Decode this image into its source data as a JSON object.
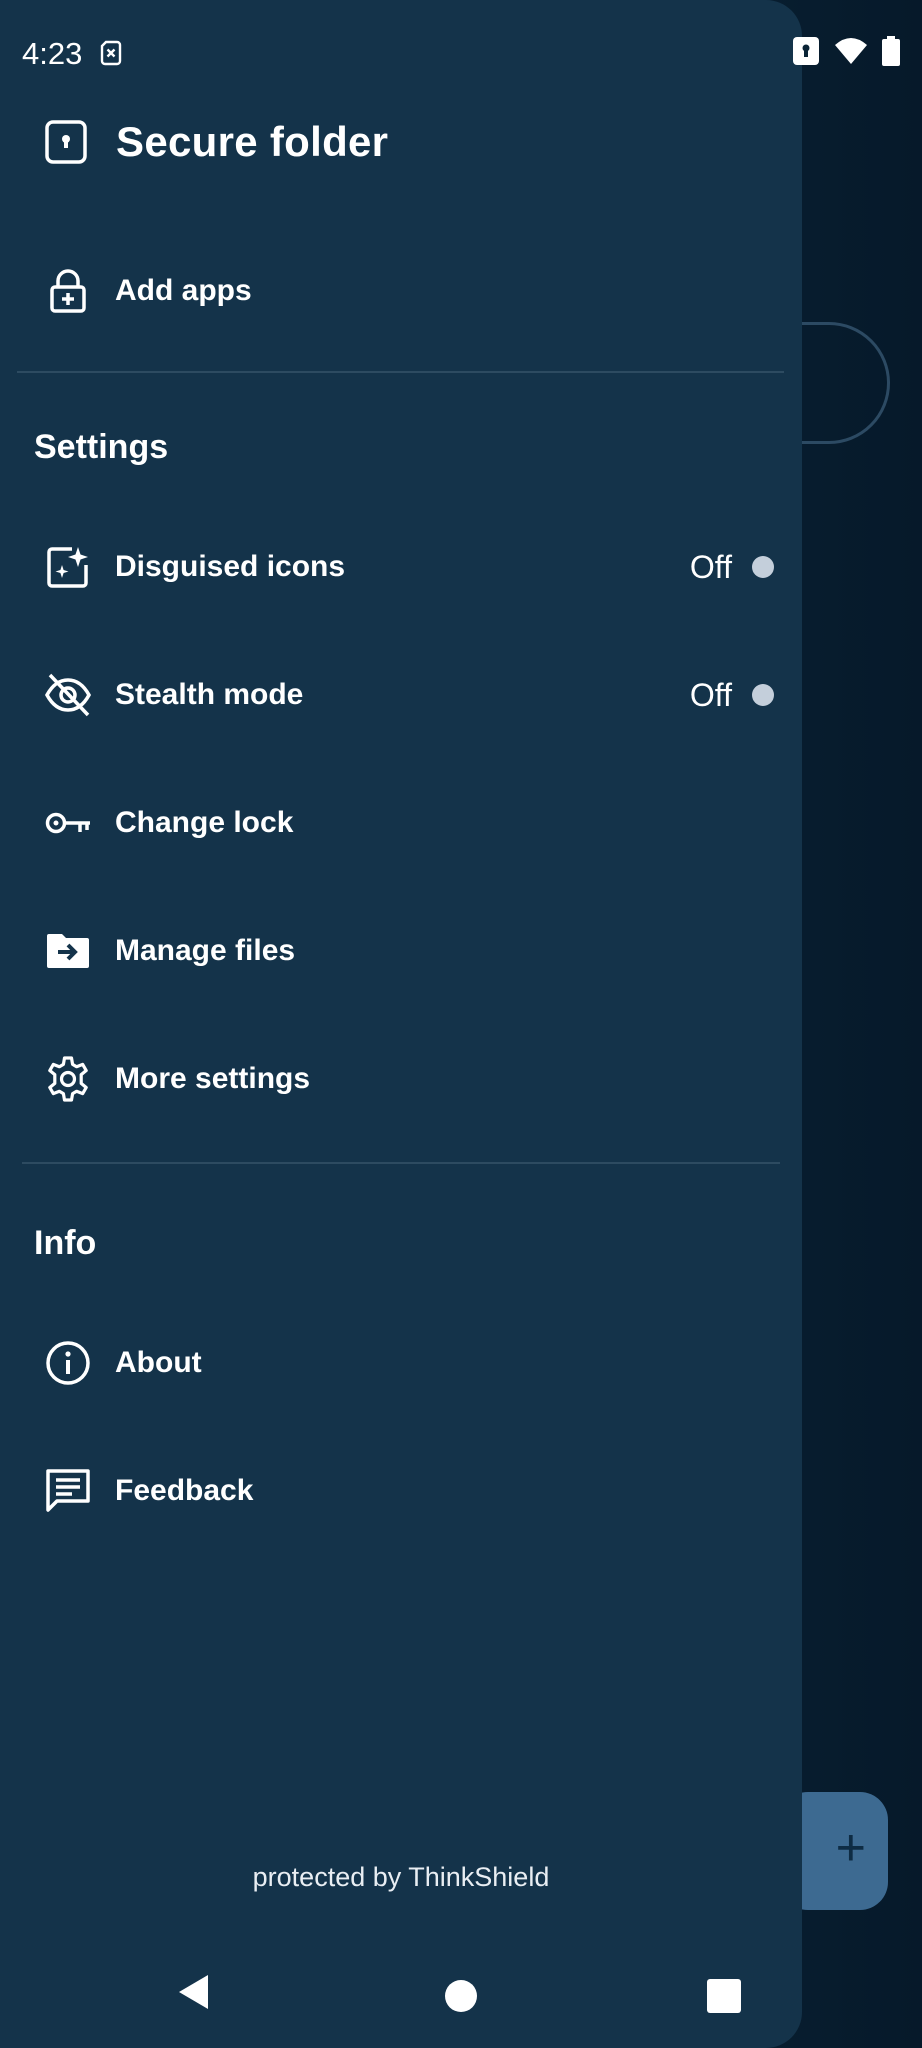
{
  "status_bar": {
    "time": "4:23",
    "icons": [
      "sim-error-icon",
      "lock-status-icon",
      "wifi-icon",
      "battery-icon"
    ]
  },
  "drawer": {
    "title": "Secure folder",
    "title_icon": "secure-folder-icon",
    "add_apps": {
      "label": "Add apps",
      "icon": "lock-add-icon"
    },
    "settings_section": "Settings",
    "settings_items": [
      {
        "label": "Disguised icons",
        "icon": "sparkle-icon",
        "value": "Off"
      },
      {
        "label": "Stealth mode",
        "icon": "eye-off-icon",
        "value": "Off"
      },
      {
        "label": "Change lock",
        "icon": "key-icon"
      },
      {
        "label": "Manage files",
        "icon": "folder-move-icon"
      },
      {
        "label": "More settings",
        "icon": "gear-icon"
      }
    ],
    "info_section": "Info",
    "info_items": [
      {
        "label": "About",
        "icon": "info-icon"
      },
      {
        "label": "Feedback",
        "icon": "feedback-icon"
      }
    ],
    "footer": "protected by ThinkShield"
  },
  "background": {
    "fab_icon": "plus-icon"
  },
  "colors": {
    "drawer_bg": "#14334a",
    "screen_bg": "#0a2436",
    "fab_bg": "#3d6a91",
    "toggle_off": "#c4cfdb"
  }
}
